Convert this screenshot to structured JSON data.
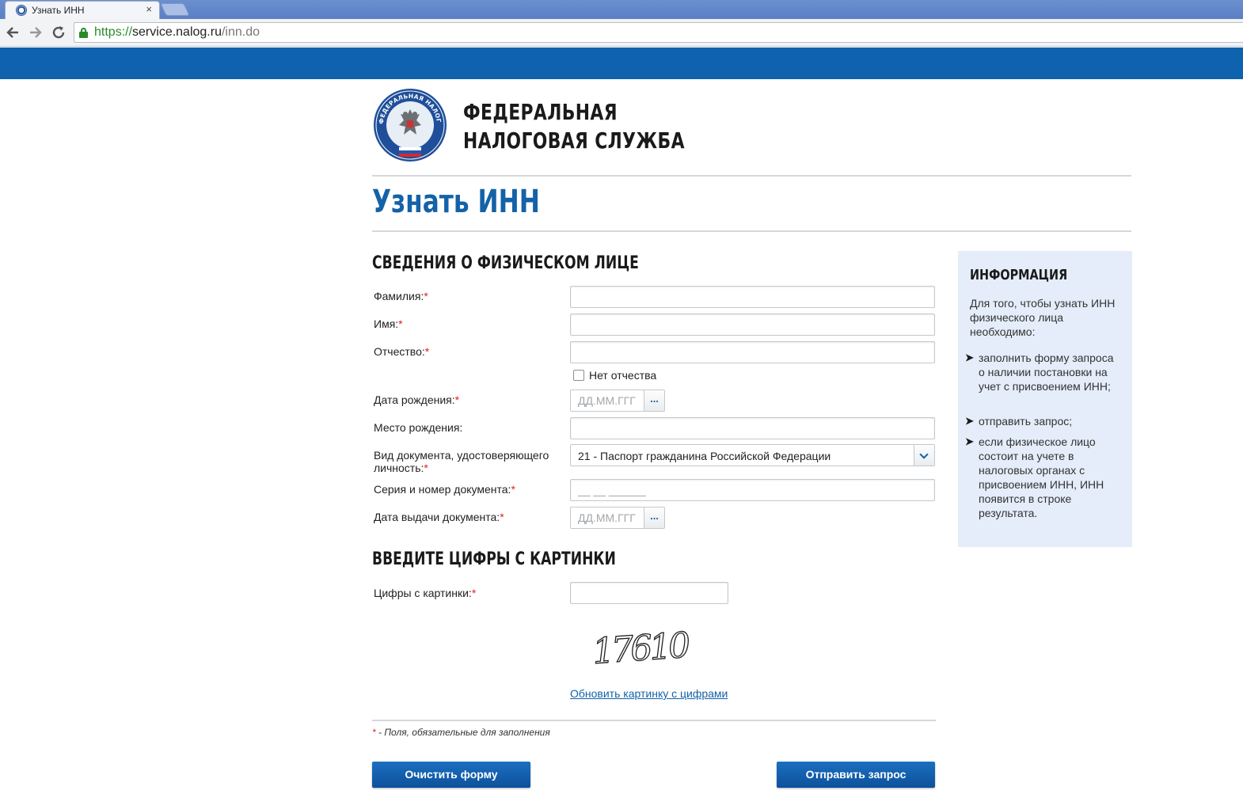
{
  "browser": {
    "tab_title": "Узнать ИНН",
    "tab_close": "×",
    "url_scheme": "https://",
    "url_host": "service.nalog.ru",
    "url_path": "/inn.do"
  },
  "header": {
    "org_line1": "ФЕДЕРАЛЬНАЯ",
    "org_line2": "НАЛОГОВАЯ СЛУЖБА",
    "logo_text": "ФЕДЕРАЛЬНАЯ НАЛОГОВАЯ СЛУЖБА"
  },
  "page_title": "Узнать ИНН",
  "person_section": {
    "title": "СВЕДЕНИЯ О ФИЗИЧЕСКОМ ЛИЦЕ",
    "surname_label": "Фамилия:",
    "name_label": "Имя:",
    "patronymic_label": "Отчество:",
    "no_patronymic_label": "Нет отчества",
    "birthdate_label": "Дата рождения:",
    "birthdate_placeholder": "ДД.ММ.ГГГ",
    "birthplace_label": "Место рождения:",
    "doctype_label_line1": "Вид документа, удостоверяющего",
    "doctype_label_line2": "личность:",
    "doctype_value": "21 - Паспорт гражданина Российской Федерации",
    "docnum_label": "Серия и номер документа:",
    "docnum_placeholder": "__ __ ______",
    "issue_date_label": "Дата выдачи документа:",
    "issue_date_placeholder": "ДД.ММ.ГГГ",
    "date_button": "...",
    "required_mark": "*"
  },
  "captcha_section": {
    "title": "ВВЕДИТЕ ЦИФРЫ С КАРТИНКИ",
    "label": "Цифры с картинки:",
    "captcha_text": "17610",
    "refresh_link": "Обновить картинку с цифрами"
  },
  "footnote": "* - Поля, обязательные для заполнения",
  "buttons": {
    "clear": "Очистить форму",
    "submit": "Отправить запрос"
  },
  "info": {
    "title": "ИНФОРМАЦИЯ",
    "intro": "Для того, чтобы узнать ИНН физического лица необходимо:",
    "items": [
      "заполнить форму запроса о наличии постановки на учет с присвоением ИНН;",
      "отправить запрос;",
      "если физическое лицо состоит на учете в налоговых органах с присвоением ИНН, ИНН появится в строке результата."
    ]
  },
  "colors": {
    "brand_blue": "#0f62ae",
    "title_blue": "#1462a8",
    "info_bg": "#e4edf9",
    "required_red": "#dd2222"
  },
  "icons": [
    "favicon-icon",
    "close-icon",
    "back-icon",
    "forward-icon",
    "reload-icon",
    "lock-icon",
    "calendar-button-icon",
    "chevron-down-icon",
    "bullet-arrow-icon"
  ]
}
